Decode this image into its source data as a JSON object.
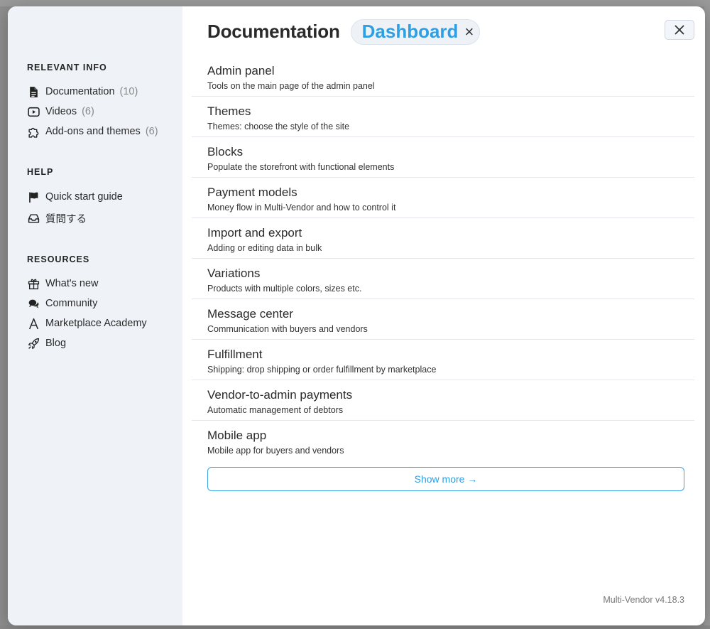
{
  "sidebar": {
    "relevant_heading": "RELEVANT INFO",
    "relevant_items": [
      {
        "label": "Documentation",
        "count": "(10)",
        "icon": "document-icon"
      },
      {
        "label": "Videos",
        "count": "(6)",
        "icon": "video-icon"
      },
      {
        "label": "Add-ons and themes",
        "count": "(6)",
        "icon": "puzzle-icon"
      }
    ],
    "help_heading": "HELP",
    "help_items": [
      {
        "label": "Quick start guide",
        "icon": "flag-icon"
      },
      {
        "label": "質問する",
        "icon": "inbox-icon"
      }
    ],
    "resources_heading": "RESOURCES",
    "resources_items": [
      {
        "label": "What's new",
        "icon": "gift-icon"
      },
      {
        "label": "Community",
        "icon": "chat-icon"
      },
      {
        "label": "Marketplace Academy",
        "icon": "academy-icon"
      },
      {
        "label": "Blog",
        "icon": "rocket-icon"
      }
    ]
  },
  "header": {
    "title": "Documentation",
    "tag_label": "Dashboard",
    "tag_close": "×"
  },
  "docs": [
    {
      "title": "Admin panel",
      "desc": "Tools on the main page of the admin panel"
    },
    {
      "title": "Themes",
      "desc": "Themes: choose the style of the site"
    },
    {
      "title": "Blocks",
      "desc": "Populate the storefront with functional elements"
    },
    {
      "title": "Payment models",
      "desc": "Money flow in Multi-Vendor and how to control it"
    },
    {
      "title": "Import and export",
      "desc": "Adding or editing data in bulk"
    },
    {
      "title": "Variations",
      "desc": "Products with multiple colors, sizes etc."
    },
    {
      "title": "Message center",
      "desc": "Communication with buyers and vendors"
    },
    {
      "title": "Fulfillment",
      "desc": "Shipping: drop shipping or order fulfillment by marketplace"
    },
    {
      "title": "Vendor-to-admin payments",
      "desc": "Automatic management of debtors"
    },
    {
      "title": "Mobile app",
      "desc": "Mobile app for buyers and vendors"
    }
  ],
  "show_more_label": "Show more →",
  "version": "Multi-Vendor v4.18.3",
  "colors": {
    "accent": "#2d9fe2",
    "sidebar_bg": "#eff3f8"
  }
}
